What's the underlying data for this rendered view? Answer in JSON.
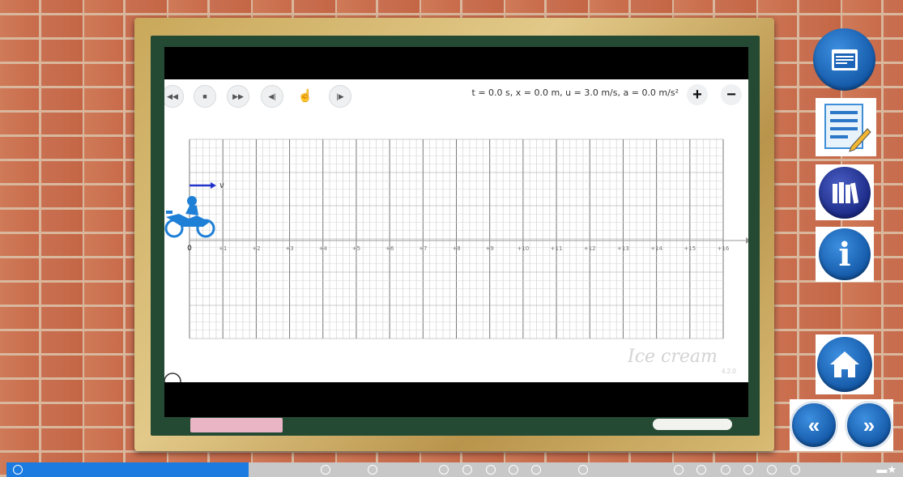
{
  "simulation": {
    "status": "t = 0.0 s,  x = 0.0 m,  u = 3.0 m/s,  a = 0.0 m/s²",
    "zoom_in": "+",
    "zoom_out": "−",
    "vector_label": "v",
    "axis_ticks": [
      "0",
      "+1",
      "+2",
      "+3",
      "+4",
      "+5",
      "+6",
      "+7",
      "+8",
      "+9",
      "+10",
      "+11",
      "+12",
      "+13",
      "+14",
      "+15",
      "+16"
    ],
    "watermark": "Ice cream",
    "watermark_sub": "4.2.0"
  },
  "controls": {
    "icons": [
      "rewind-icon",
      "stop-icon",
      "fast-forward-icon",
      "step-back-icon",
      "hand-icon",
      "step-forward-icon"
    ]
  },
  "sidebar": {
    "buttons": [
      "window-icon",
      "notes-icon",
      "library-icon",
      "info-icon",
      "home-icon",
      "previous-icon",
      "next-icon"
    ]
  },
  "progress": {
    "fraction": 0.27
  },
  "colors": {
    "accent": "#1b7be0",
    "board": "#244a34",
    "frame": "#d8bb74",
    "vector": "#2233cc"
  }
}
